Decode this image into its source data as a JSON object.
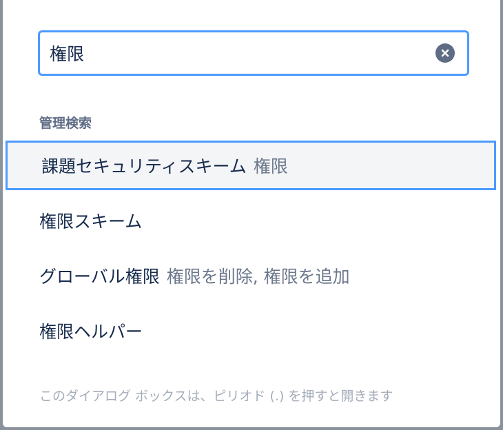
{
  "search": {
    "value": "権限",
    "clear_icon": "close-circle-icon"
  },
  "section": {
    "heading": "管理検索"
  },
  "results": [
    {
      "label": "課題セキュリティスキーム",
      "hint": "権限"
    },
    {
      "label": "権限スキーム",
      "hint": ""
    },
    {
      "label": "グローバル権限",
      "hint": "権限を削除, 権限を追加"
    },
    {
      "label": "権限ヘルパー",
      "hint": ""
    }
  ],
  "footer": {
    "hint": "このダイアログ ボックスは、ピリオド (.) を押すと開きます"
  },
  "colors": {
    "accent": "#4c9aff",
    "text": "#172b4d",
    "muted": "#6b778c",
    "selected_bg": "#f4f5f7"
  }
}
